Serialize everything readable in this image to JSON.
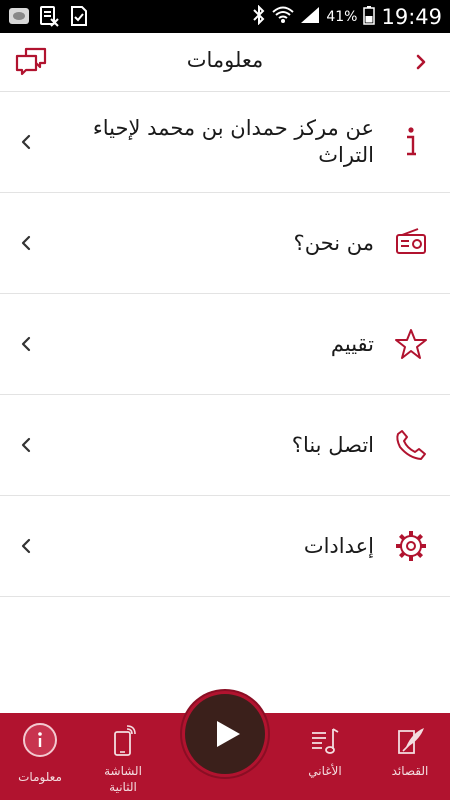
{
  "status_bar": {
    "battery_percent": "41%",
    "time": "19:49"
  },
  "header": {
    "title": "معلومات"
  },
  "menu": {
    "items": [
      {
        "label": "عن   مركز حمدان بن محمد لإحياء التراث",
        "icon": "info-icon"
      },
      {
        "label": "من نحن؟",
        "icon": "radio-icon"
      },
      {
        "label": "تقييم",
        "icon": "star-icon"
      },
      {
        "label": "اتصل بنا؟",
        "icon": "phone-icon"
      },
      {
        "label": "إعدادات",
        "icon": "gear-icon"
      }
    ]
  },
  "bottom_nav": {
    "items": [
      {
        "label": "القصائد",
        "icon": "quill-icon"
      },
      {
        "label": "الأغاني",
        "icon": "music-list-icon"
      },
      {
        "label": "الشاشة الثانية",
        "icon": "phone-cast-icon"
      },
      {
        "label": "معلومات",
        "icon": "info-circle-icon",
        "active": true
      }
    ]
  },
  "colors": {
    "accent": "#b1132f",
    "play_button": "#3b201b"
  }
}
